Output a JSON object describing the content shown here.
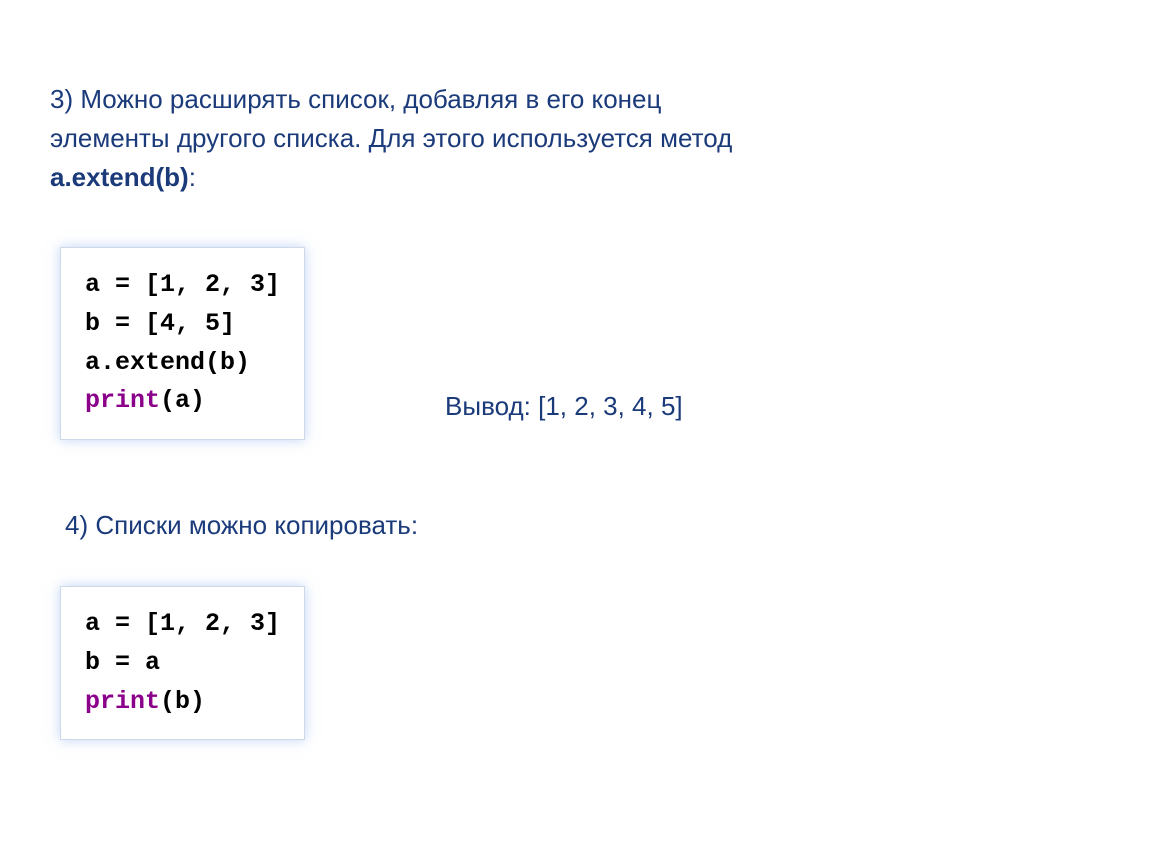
{
  "section3": {
    "text_line1": "3) Можно расширять список, добавляя в его конец",
    "text_line2": "элементы другого списка. Для этого используется метод",
    "method_bold": "a.extend(b)",
    "colon": ":"
  },
  "code_block1": {
    "line1": "a = [1, 2, 3]",
    "line2": "b = [4, 5]",
    "line3": "a.extend(b)",
    "line4_keyword": "print",
    "line4_rest": "(a)"
  },
  "output1": {
    "label": "Вывод: ",
    "value": "[1, 2, 3, 4, 5]"
  },
  "section4": {
    "text": "4) Списки можно копировать:"
  },
  "code_block2": {
    "line1": "a = [1, 2, 3]",
    "line2": "b = a",
    "line3_keyword": "print",
    "line3_rest": "(b)"
  }
}
